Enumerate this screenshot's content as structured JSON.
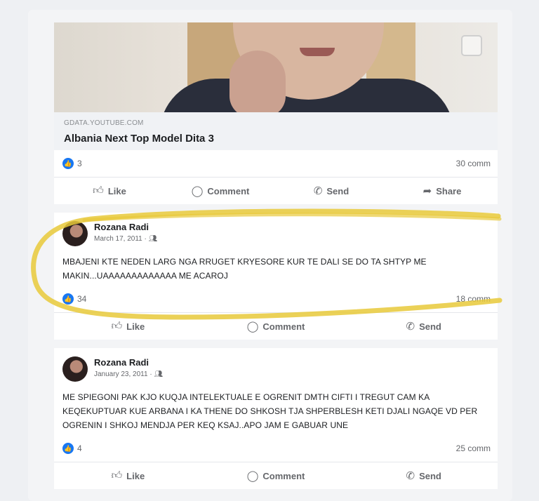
{
  "posts": [
    {
      "type": "link",
      "link": {
        "domain": "GDATA.YOUTUBE.COM",
        "title": "Albania Next Top Model Dita 3"
      },
      "reactions": "3",
      "comments": "30 comm",
      "actions": [
        "Like",
        "Comment",
        "Send",
        "Share"
      ]
    },
    {
      "type": "status",
      "author": "Rozana Radi",
      "date": "March 17, 2011",
      "text": "MBAJENI KTE NEDEN LARG NGA RRUGET KRYESORE KUR TE DALI SE DO TA SHTYP ME MAKIN...UAAAAAAAAAAAAA ME ACAROJ",
      "reactions": "34",
      "comments": "18 comm",
      "actions": [
        "Like",
        "Comment",
        "Send"
      ]
    },
    {
      "type": "status",
      "author": "Rozana Radi",
      "date": "January 23, 2011",
      "text": "ME SPIEGONI PAK KJO KUQJA INTELEKTUALE E OGRENIT DMTH CIFTI I TREGUT CAM KA KEQEKUPTUAR KUE ARBANA I KA THENE DO SHKOSH TJA SHPERBLESH KETI DJALI NGAQE VD PER OGRENIN I SHKOJ MENDJA PER KEQ KSAJ..APO JAM E GABUAR UNE",
      "reactions": "4",
      "comments": "25 comm",
      "actions": [
        "Like",
        "Comment",
        "Send"
      ]
    }
  ],
  "colors": {
    "accent": "#1877f2",
    "highlight": "#e8c93a"
  },
  "icons": [
    "like-icon",
    "comment-icon",
    "send-icon",
    "share-icon",
    "friends-icon",
    "collection-icon"
  ]
}
